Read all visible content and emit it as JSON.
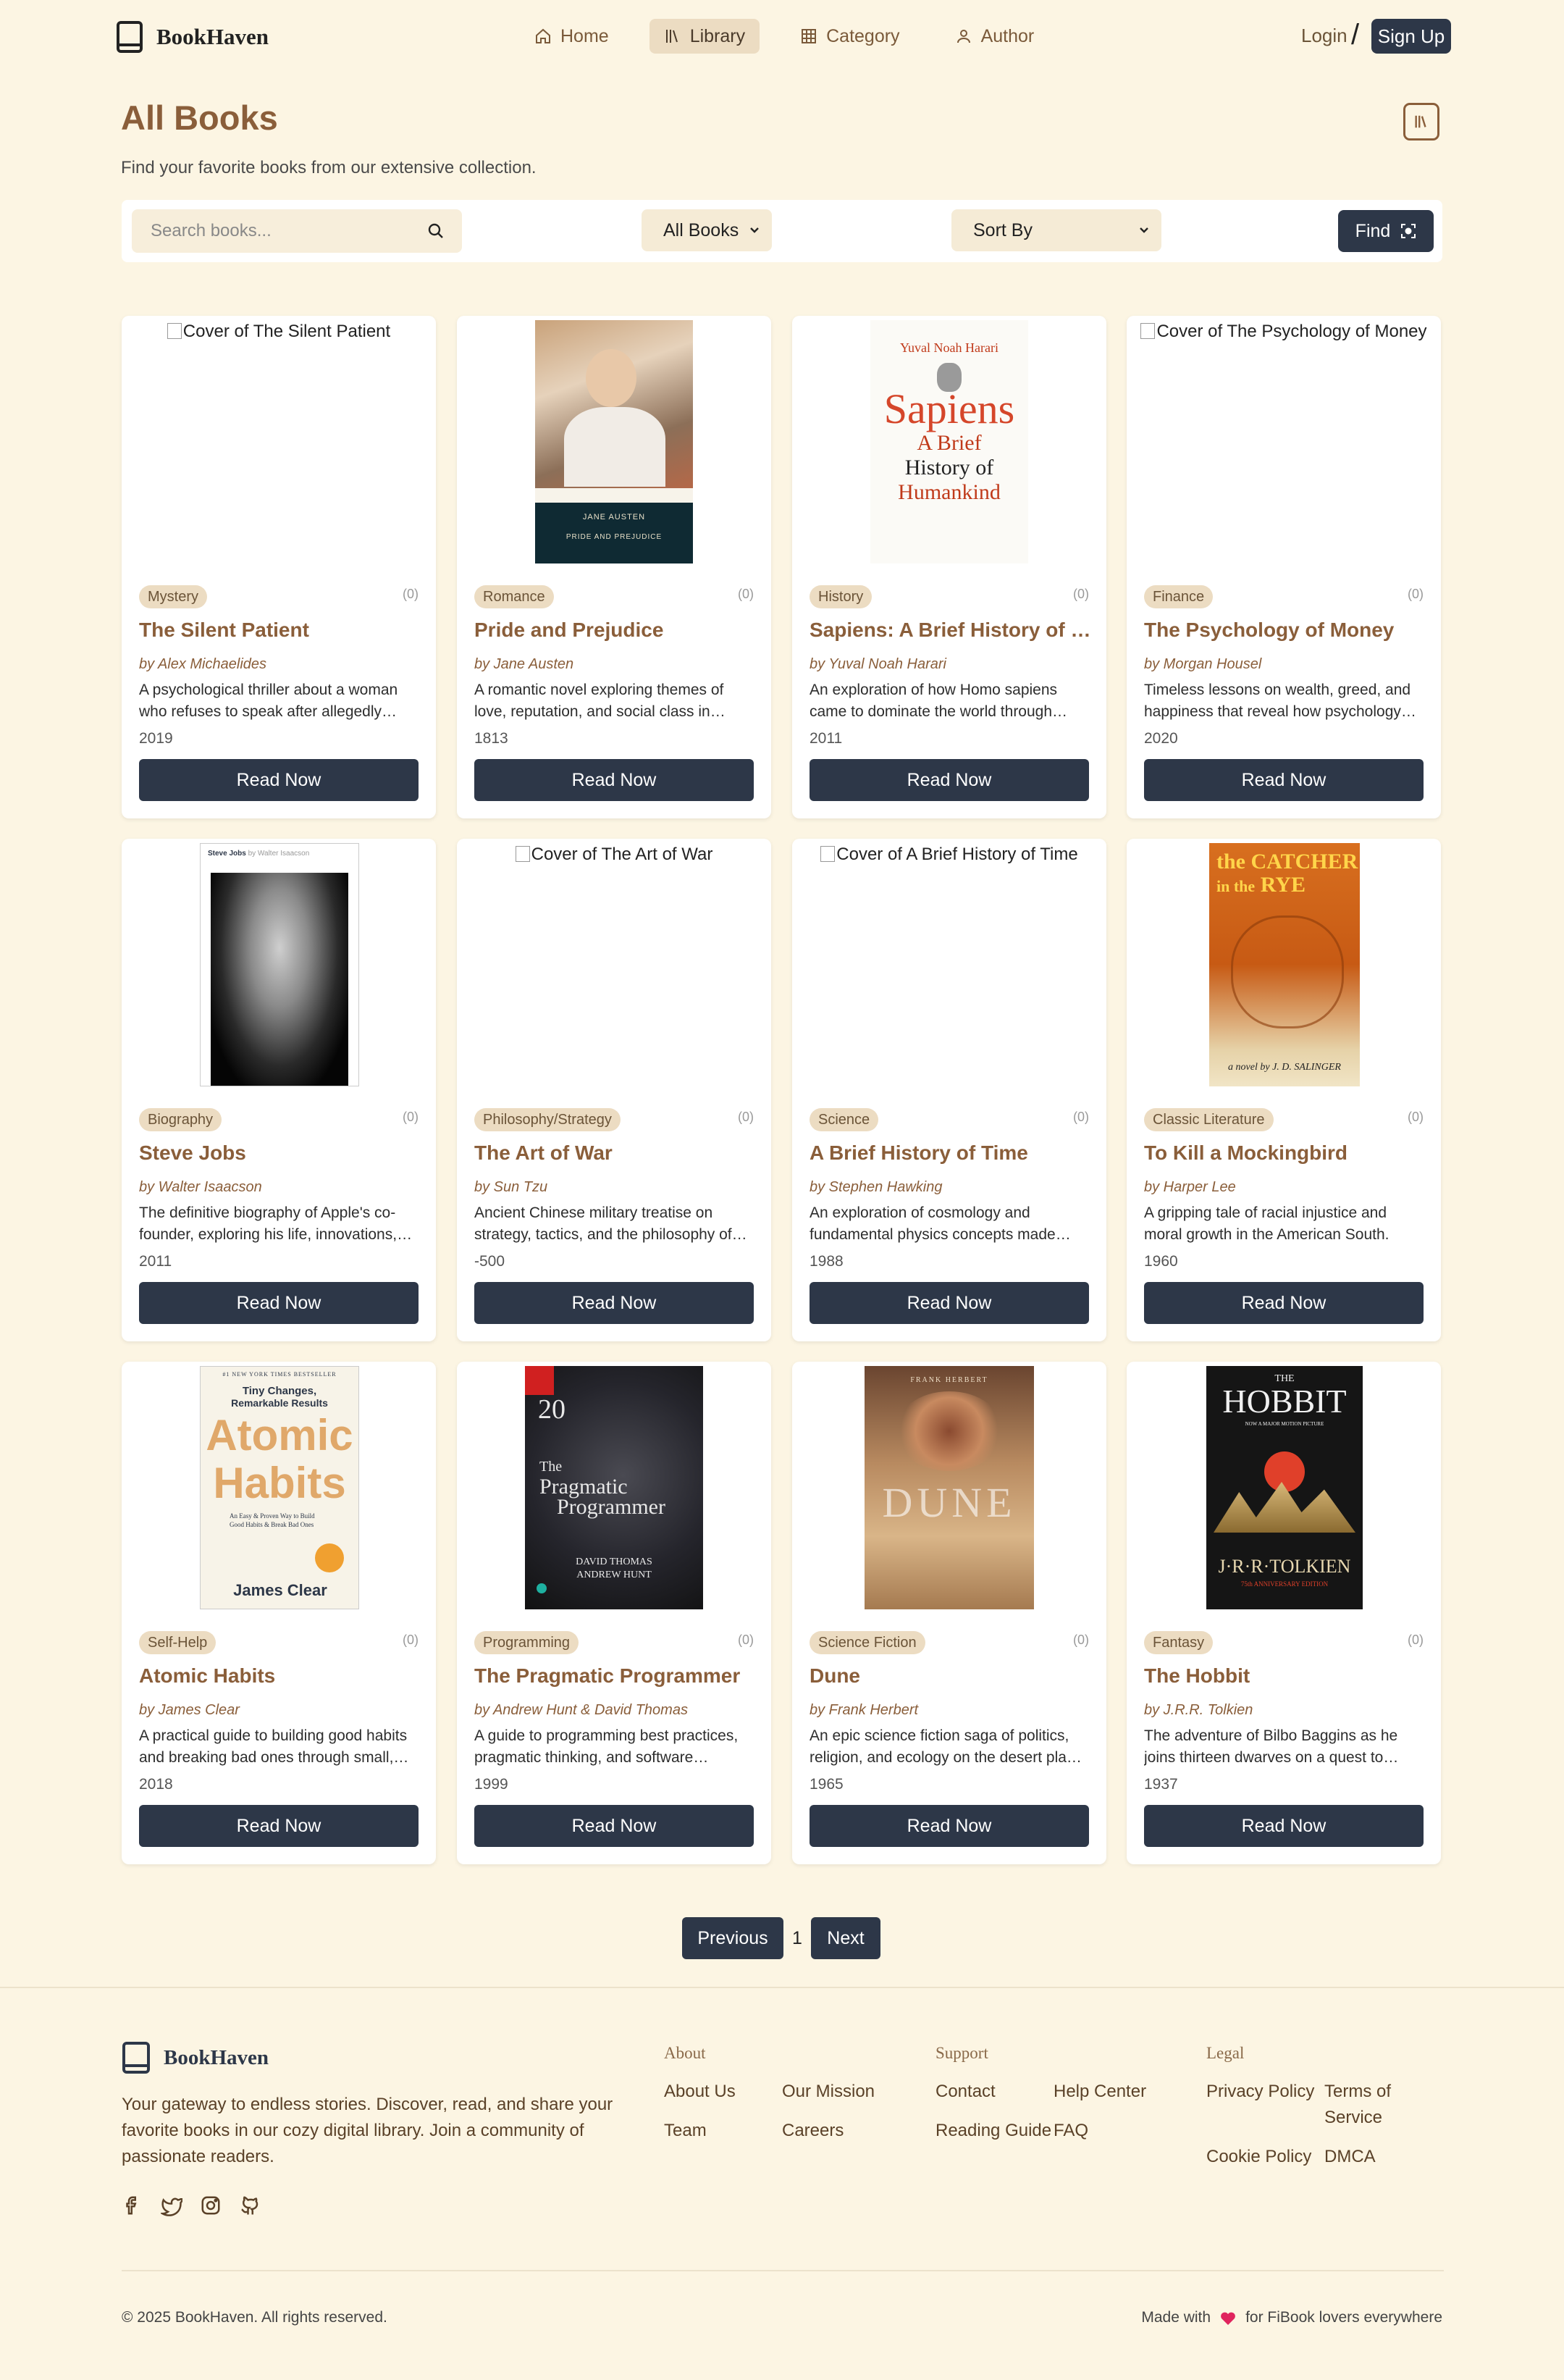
{
  "nav": {
    "brand": "BookHaven",
    "links": [
      {
        "label": "Home",
        "icon": "home-icon"
      },
      {
        "label": "Library",
        "icon": "library-icon",
        "active": true
      },
      {
        "label": "Category",
        "icon": "grid-icon"
      },
      {
        "label": "Author",
        "icon": "user-icon"
      }
    ],
    "login": "Login",
    "separator": "/",
    "signup": "Sign Up"
  },
  "header": {
    "title": "All Books",
    "subtitle": "Find your favorite books from our extensive collection."
  },
  "filters": {
    "search_placeholder": "Search books...",
    "category_value": "All Books",
    "sort_value": "Sort By",
    "find_label": "Find"
  },
  "cover_alt_prefix": "Cover of ",
  "books": [
    {
      "title": "The Silent Patient",
      "author": "by Alex Michaelides",
      "genre": "Mystery",
      "rating": "(0)",
      "description": "A psychological thriller about a woman who refuses to speak after allegedly murdering her husband.",
      "year": "2019",
      "cover": "broken",
      "read_label": "Read Now"
    },
    {
      "title": "Pride and Prejudice",
      "author": "by Jane Austen",
      "genre": "Romance",
      "rating": "(0)",
      "description": "A romantic novel exploring themes of love, reputation, and social class in Regency England.",
      "year": "1813",
      "cover": "pride",
      "cover_author": "JANE AUSTEN",
      "cover_title": "PRIDE AND PREJUDICE",
      "read_label": "Read Now"
    },
    {
      "title": "Sapiens: A Brief History of Humankind",
      "author": "by Yuval Noah Harari",
      "genre": "History",
      "rating": "(0)",
      "description": "An exploration of how Homo sapiens came to dominate the world through cognitive revolutions.",
      "year": "2011",
      "cover": "sapiens",
      "cover_author": "Yuval Noah Harari",
      "cover_title": "Sapiens",
      "cover_sub1": "A Brief",
      "cover_sub2": "History of",
      "cover_sub3": "Humankind",
      "read_label": "Read Now"
    },
    {
      "title": "The Psychology of Money",
      "author": "by Morgan Housel",
      "genre": "Finance",
      "rating": "(0)",
      "description": "Timeless lessons on wealth, greed, and happiness that reveal how psychology shapes money.",
      "year": "2020",
      "cover": "broken",
      "read_label": "Read Now"
    },
    {
      "title": "Steve Jobs",
      "author": "by Walter Isaacson",
      "genre": "Biography",
      "rating": "(0)",
      "description": "The definitive biography of Apple's co-founder, exploring his life, innovations, and legacy.",
      "year": "2011",
      "cover": "jobs",
      "cover_title": "Steve Jobs",
      "cover_author": "by Walter Isaacson",
      "read_label": "Read Now"
    },
    {
      "title": "The Art of War",
      "author": "by Sun Tzu",
      "genre": "Philosophy/Strategy",
      "rating": "(0)",
      "description": "Ancient Chinese military treatise on strategy, tactics, and the philosophy of conflict.",
      "year": "-500",
      "cover": "broken",
      "read_label": "Read Now"
    },
    {
      "title": "A Brief History of Time",
      "author": "by Stephen Hawking",
      "genre": "Science",
      "rating": "(0)",
      "description": "An exploration of cosmology and fundamental physics concepts made accessible to all.",
      "year": "1988",
      "cover": "broken",
      "read_label": "Read Now"
    },
    {
      "title": "To Kill a Mockingbird",
      "author": "by Harper Lee",
      "genre": "Classic Literature",
      "rating": "(0)",
      "description": "A gripping tale of racial injustice and moral growth in the American South.",
      "year": "1960",
      "cover": "catcher",
      "cover_t1": "the",
      "cover_t2": "CATCHER",
      "cover_t3": "in the",
      "cover_t4": "RYE",
      "cover_author": "a novel by J. D. SALINGER",
      "read_label": "Read Now"
    },
    {
      "title": "Atomic Habits",
      "author": "by James Clear",
      "genre": "Self-Help",
      "rating": "(0)",
      "description": "A practical guide to building good habits and breaking bad ones through small, consistent changes.",
      "year": "2018",
      "cover": "atomic",
      "cover_top": "#1 NEW YORK TIMES BESTSELLER",
      "cover_tag1": "Tiny Changes,",
      "cover_tag2": "Remarkable Results",
      "cover_t1": "Atomic",
      "cover_t2": "Habits",
      "cover_sub": "An Easy & Proven Way to Build Good Habits & Break Bad Ones",
      "cover_author": "James Clear",
      "read_label": "Read Now"
    },
    {
      "title": "The Pragmatic Programmer",
      "author": "by Andrew Hunt & David Thomas",
      "genre": "Programming",
      "rating": "(0)",
      "description": "A guide to programming best practices, pragmatic thinking, and software craftsmanship.",
      "year": "1999",
      "cover": "pragmatic",
      "cover_num": "20",
      "cover_t1": "The",
      "cover_t2": "Pragmatic",
      "cover_t3": "Programmer",
      "cover_a1": "DAVID THOMAS",
      "cover_a2": "ANDREW HUNT",
      "read_label": "Read Now"
    },
    {
      "title": "Dune",
      "author": "by Frank Herbert",
      "genre": "Science Fiction",
      "rating": "(0)",
      "description": "An epic science fiction saga of politics, religion, and ecology on the desert planet Arrakis.",
      "year": "1965",
      "cover": "dune",
      "cover_author": "FRANK HERBERT",
      "cover_title": "DUNE",
      "read_label": "Read Now"
    },
    {
      "title": "The Hobbit",
      "author": "by J.R.R. Tolkien",
      "genre": "Fantasy",
      "rating": "(0)",
      "description": "The adventure of Bilbo Baggins as he joins thirteen dwarves on a quest to reclaim their home.",
      "year": "1937",
      "cover": "hobbit",
      "cover_the": "THE",
      "cover_title": "HOBBIT",
      "cover_sub": "NOW A MAJOR MOTION PICTURE",
      "cover_author": "J·R·R·TOLKIEN",
      "cover_ed": "75th ANNIVERSARY EDITION",
      "read_label": "Read Now"
    }
  ],
  "pagination": {
    "prev": "Previous",
    "current": "1",
    "next": "Next"
  },
  "footer": {
    "brand": "BookHaven",
    "tagline": "Your gateway to endless stories. Discover, read, and share your favorite books in our cozy digital library. Join a community of passionate readers.",
    "socials": [
      "facebook-icon",
      "twitter-icon",
      "instagram-icon",
      "github-icon"
    ],
    "about": {
      "heading": "About",
      "links": [
        "About Us",
        "Our Mission",
        "Team",
        "Careers"
      ]
    },
    "support": {
      "heading": "Support",
      "links": [
        "Contact",
        "Help Center",
        "Reading Guide",
        "FAQ"
      ]
    },
    "legal": {
      "heading": "Legal",
      "links": [
        "Privacy Policy",
        "Terms of Service",
        "Cookie Policy",
        "DMCA"
      ]
    },
    "copyright": "© 2025 BookHaven. All rights reserved.",
    "made_prefix": "Made with",
    "made_suffix": "for FiBook lovers everywhere"
  },
  "colors": {
    "accent": "#8a5e3a",
    "button": "#2d3748",
    "background": "#fcf5e3",
    "badge": "#ecdcc2",
    "heart": "#e0245e"
  }
}
